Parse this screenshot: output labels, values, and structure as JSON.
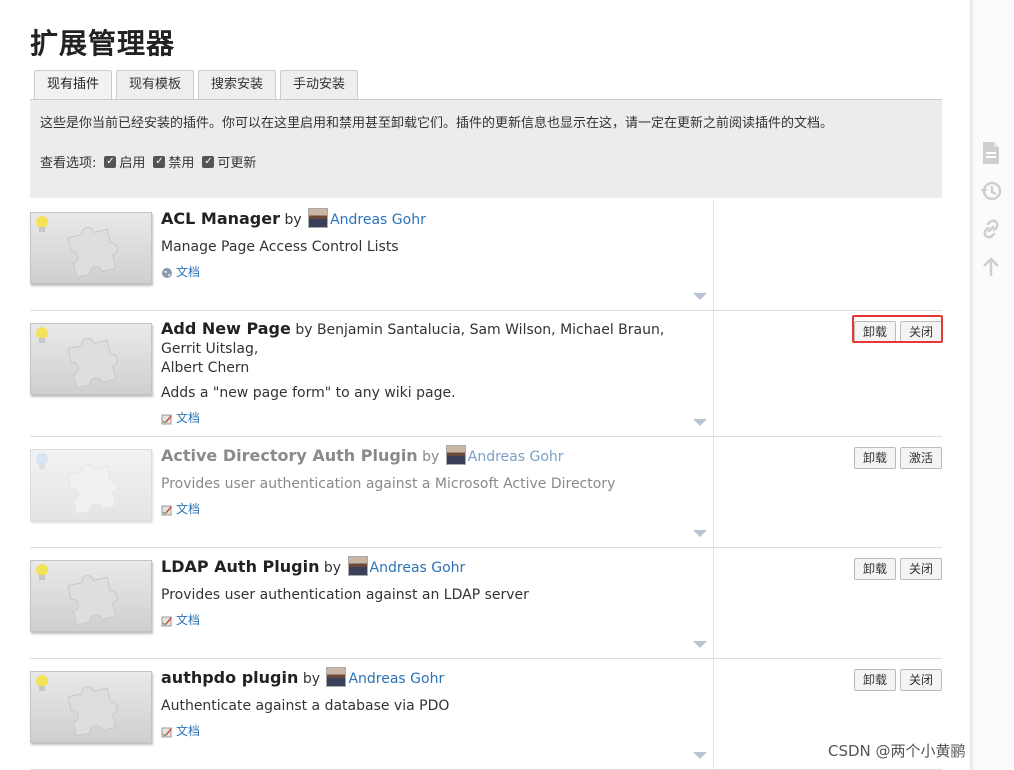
{
  "page": {
    "title": "扩展管理器",
    "tabs": [
      "现有插件",
      "现有模板",
      "搜索安装",
      "手动安装"
    ],
    "intro": "这些是你当前已经安装的插件。你可以在这里启用和禁用甚至卸载它们。插件的更新信息也显示在这，请一定在更新之前阅读插件的文档。",
    "filter_label": "查看选项:",
    "filters": [
      "启用",
      "禁用",
      "可更新"
    ]
  },
  "plugins": [
    {
      "name": "ACL Manager",
      "by": "by",
      "author": "Andreas Gohr",
      "author2": "",
      "desc": "Manage Page Access Control Lists",
      "doc": "文档",
      "btn1": "",
      "btn2": ""
    },
    {
      "name": "Add New Page",
      "by": "by",
      "author": "",
      "authors_text": "Benjamin Santalucia, Sam Wilson, Michael Braun, Gerrit Uitslag,",
      "author2": "Albert Chern",
      "desc": "Adds a \"new page form\" to any wiki page.",
      "doc": "文档",
      "btn1": "卸载",
      "btn2": "关闭"
    },
    {
      "name": "Active Directory Auth Plugin",
      "by": "by",
      "author": "Andreas Gohr",
      "author2": "",
      "desc": "Provides user authentication against a Microsoft Active Directory",
      "doc": "文档",
      "btn1": "卸载",
      "btn2": "激活"
    },
    {
      "name": "LDAP Auth Plugin",
      "by": "by",
      "author": "Andreas Gohr",
      "author2": "",
      "desc": "Provides user authentication against an LDAP server",
      "doc": "文档",
      "btn1": "卸载",
      "btn2": "关闭"
    },
    {
      "name": "authpdo plugin",
      "by": "by",
      "author": "Andreas Gohr",
      "author2": "",
      "desc": "Authenticate against a database via PDO",
      "doc": "文档",
      "btn1": "卸载",
      "btn2": "关闭"
    }
  ],
  "watermark": "CSDN @两个小黄鹂",
  "colors": {
    "link": "#2b73b7",
    "highlight": "#e53935",
    "panel": "#ececec"
  }
}
